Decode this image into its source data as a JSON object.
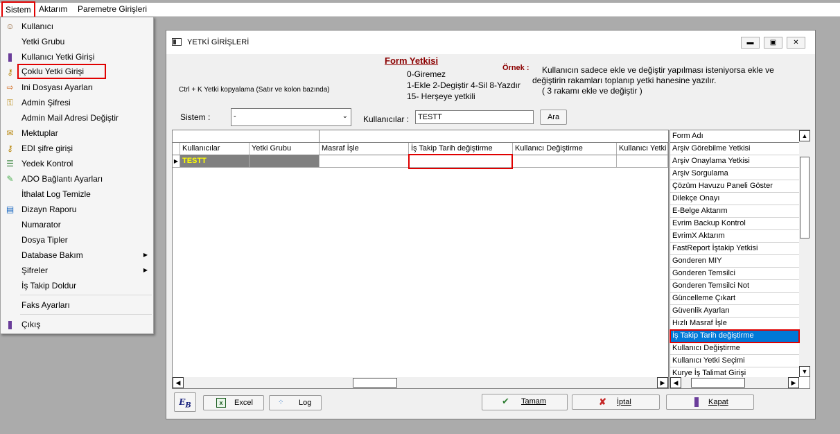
{
  "menubar": {
    "items": [
      "Sistem",
      "Aktarım",
      "Paremetre Girişleri"
    ]
  },
  "menu": {
    "items": [
      {
        "label": "Kullanıcı",
        "icon": "user-icon"
      },
      {
        "label": "Yetki Grubu",
        "icon": ""
      },
      {
        "label": "Kullanıcı Yetki Girişi",
        "icon": "user-key-icon"
      },
      {
        "label": "Çoklu Yetki Girişi",
        "icon": "keys-icon"
      },
      {
        "label": "Ini Dosyası  Ayarları",
        "icon": "ini-file-icon"
      },
      {
        "label": "Admin Şifresi",
        "icon": "key-icon"
      },
      {
        "label": "Admin Mail Adresi Değiştir",
        "icon": ""
      },
      {
        "label": "Mektuplar",
        "icon": "letters-icon"
      },
      {
        "label": "EDI şifre girişi",
        "icon": "keys-icon"
      },
      {
        "label": "Yedek Kontrol",
        "icon": "backup-icon"
      },
      {
        "label": "ADO Bağlantı Ayarları",
        "icon": "connection-icon"
      },
      {
        "label": "İthalat Log Temizle",
        "icon": ""
      },
      {
        "label": "Dizayn Raporu",
        "icon": "report-icon"
      },
      {
        "label": "Numarator",
        "icon": ""
      },
      {
        "label": "Dosya Tipler",
        "icon": ""
      },
      {
        "label": "Database Bakım",
        "icon": "",
        "submenu": true
      },
      {
        "label": "Şifreler",
        "icon": "",
        "submenu": true
      },
      {
        "label": "İş Takip Doldur",
        "icon": ""
      },
      {
        "label": "Faks Ayarları",
        "icon": ""
      },
      {
        "label": "Çıkış",
        "icon": "exit-icon"
      }
    ]
  },
  "window": {
    "title": "YETKİ GİRİŞLERİ",
    "form_title": "Form Yetkisi",
    "codes": [
      "0-Giremez",
      "1-Ekle  2-Degiştir  4-Sil  8-Yazdır",
      "15- Herşeye yetkili"
    ],
    "ornek_label": "Örnek :",
    "ornek_lines": [
      "Kullanıcın sadece ekle ve değiştir yapılması isteniyorsa  ekle ve",
      "değiştirin rakamları toplanıp yetki hanesine yazılır.",
      " ( 3 rakamı ekle ve değiştir )"
    ],
    "copy_hint": "Ctrl + K Yetki kopyalama (Satır ve kolon bazında)",
    "sistem_label": "Sistem :",
    "sistem_value": "-",
    "kullanicilar_label": "Kullanıcılar :",
    "kullanicilar_value": "TESTT",
    "ara_label": "Ara"
  },
  "grid": {
    "columns": [
      "Kullanıcılar",
      "Yetki Grubu",
      "Masraf İşle",
      "İş Takip Tarih değiştirme",
      "Kullanıcı Değiştirme",
      "Kullanıcı Yetki S"
    ],
    "rows": [
      {
        "user": "TESTT",
        "group": "",
        "masraf": "",
        "is_takip": "",
        "degistirme": "",
        "yetki_s": ""
      }
    ]
  },
  "form_list": {
    "header": "Form Adı",
    "items": [
      "Arşiv Görebilme Yetkisi",
      "Arşiv Onaylama Yetkisi",
      "Arşiv Sorgulama",
      "Çözüm Havuzu Paneli Göster",
      "Dilekçe Onayı",
      "E-Belge Aktarım",
      "Evrim Backup Kontrol",
      "EvrimX Aktarım",
      "FastReport İştakip Yetkisi",
      "Gonderen MIY",
      "Gonderen Temsilci",
      "Gonderen Temsilci Not",
      "Güncelleme Çıkart",
      "Güvenlik Ayarları",
      "Hızlı Masraf İşle",
      "İş Takip Tarih değiştirme",
      "Kullanıcı Değiştirme",
      "Kullanıcı Yetki Seçimi",
      "Kurye İş Talimat Girişi"
    ],
    "selected_index": 15
  },
  "toolbar": {
    "excel_label": "Excel",
    "log_label": "Log",
    "tamam_label": "Tamam",
    "iptal_label": "İptal",
    "kapat_label": "Kapat"
  },
  "colors": {
    "highlight": "#e00000",
    "selection": "#0078d7",
    "current_row": "#808080",
    "current_row_text": "#ffff00",
    "form_title": "#8b0000"
  }
}
